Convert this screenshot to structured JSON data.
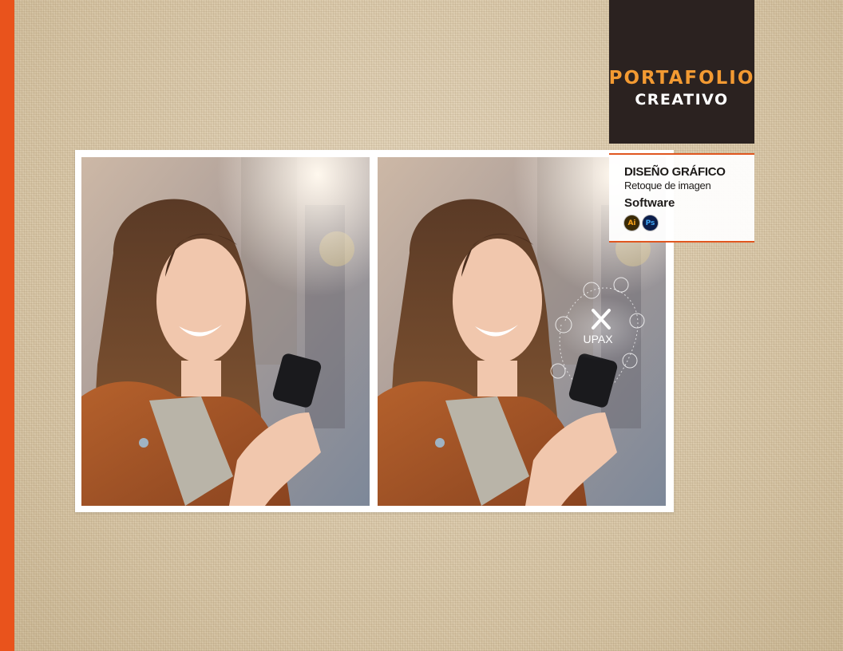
{
  "page": {
    "title_line1": "PORTAFOLIO",
    "title_line2": "CREATIVO"
  },
  "colors": {
    "accent_orange": "#e9531c",
    "title_orange": "#f39a32",
    "dark_block": "#2b2220",
    "ai_bg": "#3a2a06",
    "ai_fg": "#f7a21b",
    "ps_bg": "#0b1d4a",
    "ps_fg": "#3fa5f5"
  },
  "info": {
    "category": "DISEÑO GRÁFICO",
    "subcategory": "Retoque de imagen",
    "software_label": "Software",
    "software": [
      {
        "icon": "illustrator-icon",
        "label": "Ai"
      },
      {
        "icon": "photoshop-icon",
        "label": "Ps"
      }
    ]
  },
  "overlay": {
    "brand": "UPAX",
    "icons": [
      "list-icon",
      "people-icon",
      "cart-icon",
      "camera-icon",
      "video-icon",
      "location-icon"
    ]
  }
}
